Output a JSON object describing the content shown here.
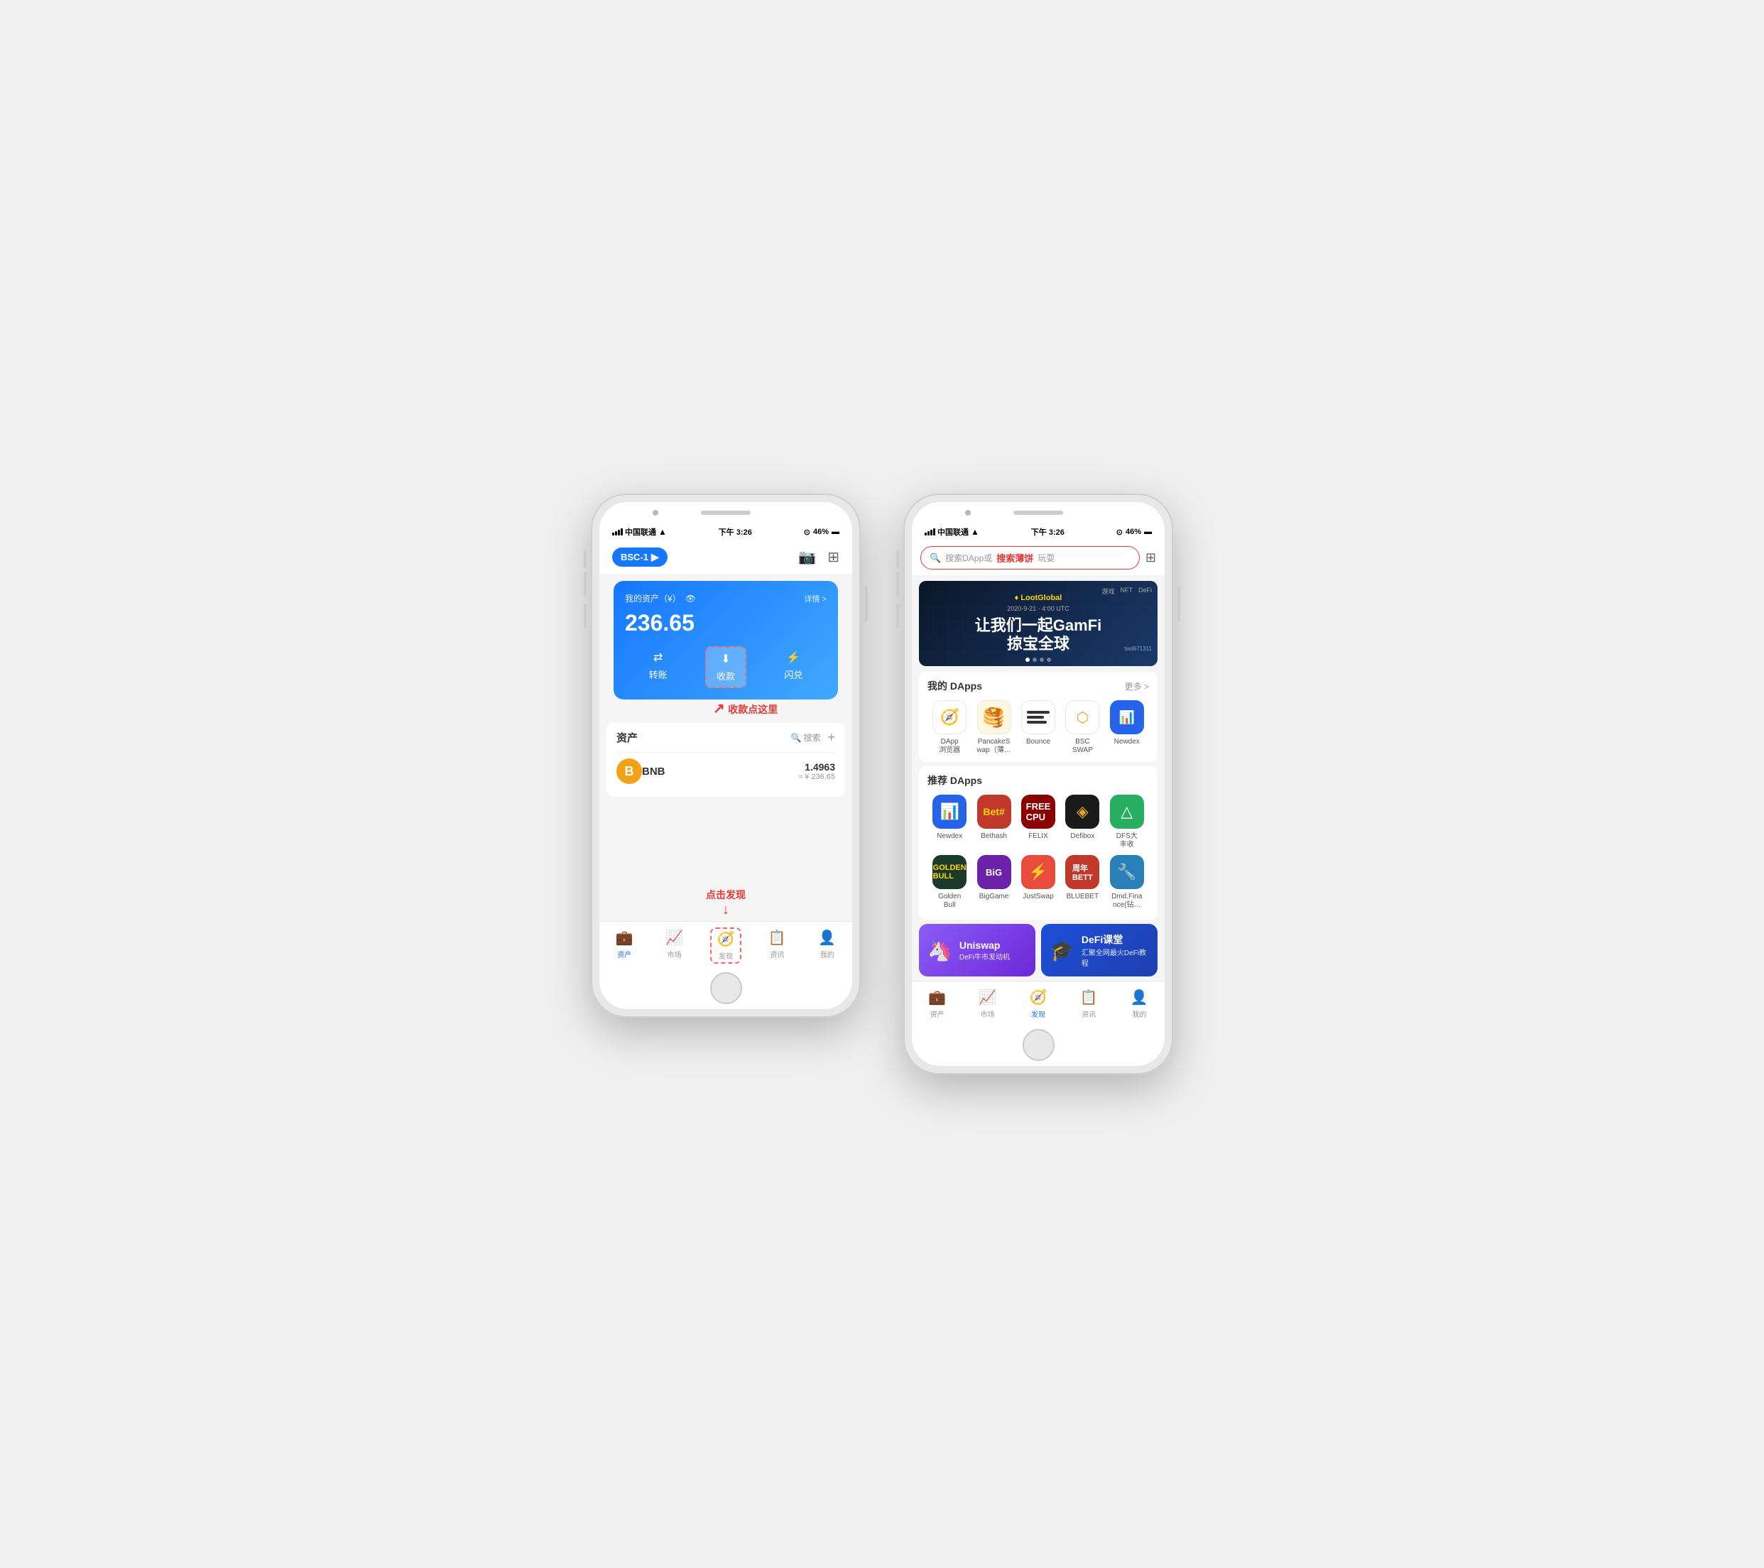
{
  "leftPhone": {
    "statusBar": {
      "carrier": "中国联通",
      "time": "下午 3:26",
      "battery": "46%"
    },
    "header": {
      "network": "BSC-1",
      "cameraIcon": "📷",
      "qrIcon": "⊞"
    },
    "assetCard": {
      "label": "我的资产（¥）",
      "detailLabel": "详情 >",
      "amount": "236.65",
      "actions": [
        {
          "icon": "⇄",
          "label": "转账"
        },
        {
          "icon": "↓",
          "label": "收款",
          "highlighted": true
        },
        {
          "icon": "⚡",
          "label": "闪兑"
        }
      ]
    },
    "annotation1": {
      "text": "收款点这里",
      "arrow": "↗"
    },
    "assetsSection": {
      "title": "资产",
      "searchLabel": "搜索",
      "tokens": [
        {
          "symbol": "BNB",
          "name": "BNB",
          "balance": "1.4963",
          "value": "≈ ¥ 236.65"
        }
      ]
    },
    "bottomNav": [
      {
        "icon": "💼",
        "label": "资产",
        "active": true
      },
      {
        "icon": "📈",
        "label": "市场",
        "active": false
      },
      {
        "icon": "🧭",
        "label": "发现",
        "active": false,
        "highlighted": true
      },
      {
        "icon": "📋",
        "label": "资讯",
        "active": false
      },
      {
        "icon": "👤",
        "label": "我的",
        "active": false
      }
    ],
    "annotation2": {
      "text": "点击发现",
      "arrow": "↑"
    }
  },
  "rightPhone": {
    "statusBar": {
      "carrier": "中国联通",
      "time": "下午 3:26",
      "battery": "46%"
    },
    "searchBar": {
      "placeholder": "搜索DApp或",
      "highlight": "搜索薄饼",
      "suffix": "玩耍"
    },
    "banner": {
      "logo": "LootGlobal",
      "categories": [
        "游戏",
        "NFT",
        "DeFi"
      ],
      "mainText": "让我们一起GamFi\n掠宝全球",
      "tag": "twd671311"
    },
    "myDapps": {
      "title": "我的 DApps",
      "moreLabel": "更多 >",
      "items": [
        {
          "icon": "compass",
          "label": "DApp\n浏览器",
          "bg": "#fff",
          "color": "#007aff"
        },
        {
          "icon": "pancake",
          "label": "PancakeS\nwap（薄…",
          "bg": "#fff8e1",
          "color": "#f3a217"
        },
        {
          "icon": "bounce",
          "label": "Bounce",
          "bg": "#fff",
          "color": "#333"
        },
        {
          "icon": "bscswap",
          "label": "BSC\nSWAP",
          "bg": "#fff",
          "color": "#f3a217"
        },
        {
          "icon": "newdex",
          "label": "Newdex",
          "bg": "#2563eb",
          "color": "#fff"
        }
      ]
    },
    "recommendedDapps": {
      "title": "推荐 DApps",
      "row1": [
        {
          "label": "Newdex",
          "bg": "#2563eb",
          "color": "#fff",
          "emoji": "📊"
        },
        {
          "label": "Bethash",
          "bg": "#c0392b",
          "color": "#fff",
          "emoji": "🎲"
        },
        {
          "label": "FELIX",
          "bg": "#8b0000",
          "color": "#fff",
          "emoji": "🎮"
        },
        {
          "label": "Defibox",
          "bg": "#1a1a2e",
          "color": "#e6a817",
          "emoji": "📦"
        },
        {
          "label": "DFS大\n丰收",
          "bg": "#27ae60",
          "color": "#fff",
          "emoji": "△"
        }
      ],
      "row2": [
        {
          "label": "Golden\nBull",
          "bg": "#1a3a2a",
          "color": "#ffd700",
          "emoji": "🐂"
        },
        {
          "label": "BigGame",
          "bg": "#6b21a8",
          "color": "#fff",
          "emoji": "🎮"
        },
        {
          "label": "JustSwap",
          "bg": "#e74c3c",
          "color": "#fff",
          "emoji": "⚡"
        },
        {
          "label": "BLUEBET",
          "bg": "#c0392b",
          "color": "#fff",
          "emoji": "🎯"
        },
        {
          "label": "Dmd.Fina\nnce(钻…",
          "bg": "#2980b9",
          "color": "#fff",
          "emoji": "💎"
        }
      ]
    },
    "promoCards": [
      {
        "title": "Uniswap",
        "subtitle": "DeFi牛市发动机",
        "bg1": "#8b5cf6",
        "bg2": "#6d28d9",
        "emoji": "🦄"
      },
      {
        "title": "DeFi课堂",
        "subtitle": "汇聚全网最火DeFi教程",
        "bg1": "#1d4ed8",
        "bg2": "#1e40af",
        "emoji": "🎓"
      }
    ],
    "bottomNav": [
      {
        "icon": "💼",
        "label": "资产",
        "active": false
      },
      {
        "icon": "📈",
        "label": "市场",
        "active": false
      },
      {
        "icon": "🧭",
        "label": "发现",
        "active": true
      },
      {
        "icon": "📋",
        "label": "资讯",
        "active": false
      },
      {
        "icon": "👤",
        "label": "我的",
        "active": false
      }
    ]
  }
}
